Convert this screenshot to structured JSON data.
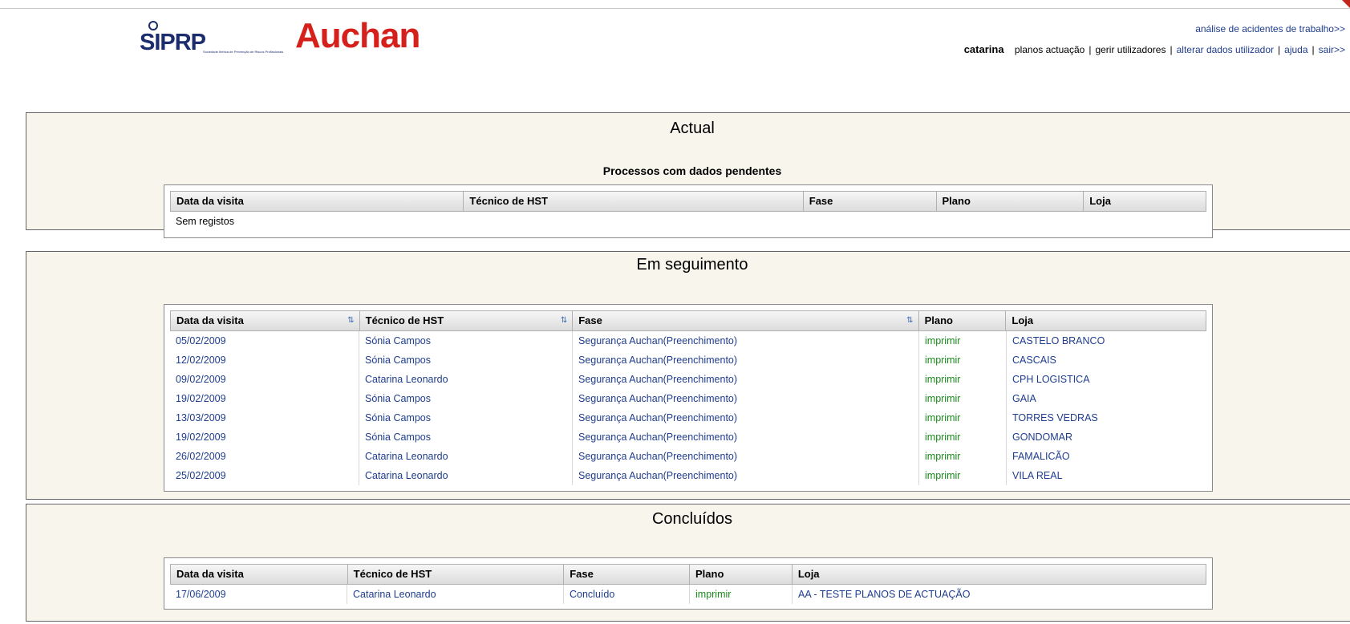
{
  "header": {
    "siprp_logo": "SIPRP",
    "siprp_tagline": "Sociedade Ibérica de Prevenção de Riscos Profissionais",
    "auchan_logo": "Auchan",
    "accident_link": "análise de acidentes de trabalho>>",
    "user": "catarina",
    "nav": [
      {
        "label": "planos actuação",
        "type": "plain"
      },
      {
        "label": "gerir utilizadores",
        "type": "plain"
      },
      {
        "label": "alterar dados utilizador",
        "type": "link"
      },
      {
        "label": "ajuda",
        "type": "link"
      },
      {
        "label": "sair>>",
        "type": "link"
      }
    ]
  },
  "actual": {
    "title": "Actual",
    "subtitle": "Processos com dados pendentes",
    "columns": [
      "Data da visita",
      "Técnico de HST",
      "Fase",
      "Plano",
      "Loja"
    ],
    "empty_text": "Sem registos"
  },
  "seguimento": {
    "title": "Em seguimento",
    "columns": [
      "Data da visita",
      "Técnico de HST",
      "Fase",
      "Plano",
      "Loja"
    ],
    "rows": [
      [
        "05/02/2009",
        "Sónia Campos",
        "Segurança Auchan(Preenchimento)",
        "imprimir",
        "CASTELO BRANCO"
      ],
      [
        "12/02/2009",
        "Sónia Campos",
        "Segurança Auchan(Preenchimento)",
        "imprimir",
        "CASCAIS"
      ],
      [
        "09/02/2009",
        "Catarina Leonardo",
        "Segurança Auchan(Preenchimento)",
        "imprimir",
        "CPH LOGISTICA"
      ],
      [
        "19/02/2009",
        "Sónia Campos",
        "Segurança Auchan(Preenchimento)",
        "imprimir",
        "GAIA"
      ],
      [
        "13/03/2009",
        "Sónia Campos",
        "Segurança Auchan(Preenchimento)",
        "imprimir",
        "TORRES VEDRAS"
      ],
      [
        "19/02/2009",
        "Sónia Campos",
        "Segurança Auchan(Preenchimento)",
        "imprimir",
        "GONDOMAR"
      ],
      [
        "26/02/2009",
        "Catarina Leonardo",
        "Segurança Auchan(Preenchimento)",
        "imprimir",
        "FAMALICÃO"
      ],
      [
        "25/02/2009",
        "Catarina Leonardo",
        "Segurança Auchan(Preenchimento)",
        "imprimir",
        "VILA REAL"
      ]
    ]
  },
  "concluidos": {
    "title": "Concluídos",
    "columns": [
      "Data da visita",
      "Técnico de HST",
      "Fase",
      "Plano",
      "Loja"
    ],
    "rows": [
      [
        "17/06/2009",
        "Catarina Leonardo",
        "Concluído",
        "imprimir",
        "AA - TESTE PLANOS DE ACTUAÇÃO"
      ]
    ]
  },
  "colors": {
    "link": "#1f3d8f",
    "print_link": "#1a8a1a",
    "panel_bg": "#f7f5ec",
    "brand_red": "#d6201b",
    "brand_blue": "#1c2c6c"
  },
  "icons": {
    "sort": "sort-arrows-icon"
  }
}
